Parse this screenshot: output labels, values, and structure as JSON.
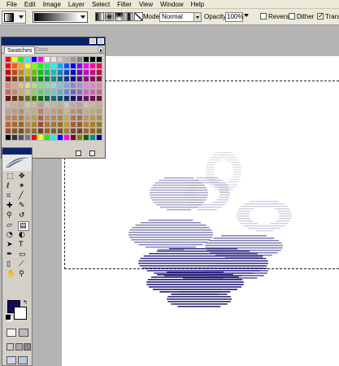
{
  "menu": [
    "File",
    "Edit",
    "Image",
    "Layer",
    "Select",
    "Filter",
    "View",
    "Window",
    "Help"
  ],
  "options": {
    "mode_label": "Mode:",
    "mode_value": "Normal",
    "opacity_label": "Opacity:",
    "opacity_value": "100%",
    "reverse_label": "Reverse",
    "dither_label": "Dither",
    "transparency_label": "Transpa",
    "reverse_checked": false,
    "dither_checked": false,
    "transparency_checked": true
  },
  "palette": {
    "tab_swatches": "Swatches",
    "tab_color": "Color"
  },
  "colors": {
    "foreground": "#130b59",
    "background": "#ffffff",
    "accent_title": "#0a246a"
  },
  "tools": [
    "marquee-icon",
    "move-icon",
    "lasso-icon",
    "magic-wand-icon",
    "crop-icon",
    "slice-icon",
    "healing-brush-icon",
    "brush-icon",
    "clone-stamp-icon",
    "history-brush-icon",
    "eraser-icon",
    "gradient-icon",
    "blur-icon",
    "dodge-icon",
    "path-selection-icon",
    "type-icon",
    "pen-icon",
    "shape-icon",
    "notes-icon",
    "eyedropper-icon",
    "hand-icon",
    "zoom-icon"
  ]
}
